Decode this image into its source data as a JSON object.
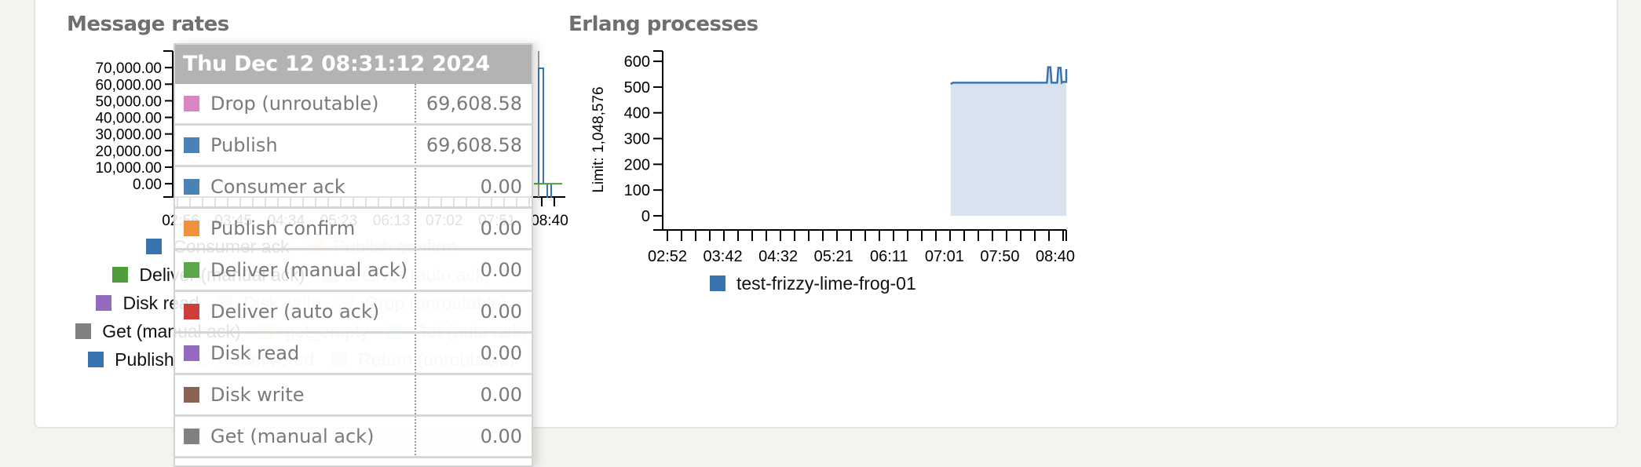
{
  "message_rates": {
    "title": "Message rates",
    "chart_data": {
      "type": "line",
      "title": "Message rates",
      "y_ticks": [
        "70,000.00",
        "60,000.00",
        "50,000.00",
        "40,000.00",
        "30,000.00",
        "20,000.00",
        "10,000.00",
        "0.00"
      ],
      "y_tick_values": [
        70000,
        60000,
        50000,
        40000,
        30000,
        20000,
        10000,
        0
      ],
      "ylim": [
        -8000,
        80000
      ],
      "x_ticks": [
        "02:56",
        "03:45",
        "04:34",
        "05:23",
        "06:13",
        "07:02",
        "07:51",
        "08:40"
      ],
      "series": [
        {
          "name": "Publish",
          "color": "#3a74b0",
          "note": "spike near 08:31",
          "peak": 69608.58
        },
        {
          "name": "Drop (unroutable)",
          "color": "#d785c3",
          "peak": 69608.58
        },
        {
          "name": "Deliver (manual ack)",
          "color": "#4f9d3a",
          "value": 0
        }
      ]
    },
    "legend_rows": [
      [
        {
          "label": "Consumer ack",
          "color": "#3a74b0"
        },
        {
          "label": "Publish confirm",
          "color": "#f0913f"
        }
      ],
      [
        {
          "label": "Deliver (manual ack)",
          "color": "#4f9d3a"
        },
        {
          "label": "Deliver (auto ack)",
          "color": "#cc3f3a"
        }
      ],
      [
        {
          "label": "Disk read",
          "color": "#936ac0"
        },
        {
          "label": "Disk write",
          "color": "#8c6255"
        },
        {
          "label": "Drop (unroutable)",
          "color": "#d785c3"
        }
      ],
      [
        {
          "label": "Get (manual ack)",
          "color": "#808080"
        },
        {
          "label": "get_empty",
          "color": "#bcbd22"
        },
        {
          "label": "Get (auto ack)",
          "color": "#17becf"
        }
      ],
      [
        {
          "label": "Publish",
          "color": "#3a74b0"
        },
        {
          "label": "Redelivered",
          "color": "#f0913f"
        },
        {
          "label": "Return (unroutable)",
          "color": "#4f9d3a"
        }
      ]
    ]
  },
  "tooltip": {
    "timestamp": "Thu Dec 12 08:31:12 2024",
    "rows": [
      {
        "label": "Drop (unroutable)",
        "value": "69,608.58",
        "color": "#d785c3"
      },
      {
        "label": "Publish",
        "value": "69,608.58",
        "color": "#4a82b8"
      },
      {
        "label": "Consumer ack",
        "value": "0.00",
        "color": "#4a82b8"
      },
      {
        "label": "Publish confirm",
        "value": "0.00",
        "color": "#f0913f"
      },
      {
        "label": "Deliver (manual ack)",
        "value": "0.00",
        "color": "#5aa64a"
      },
      {
        "label": "Deliver (auto ack)",
        "value": "0.00",
        "color": "#cc3f3a"
      },
      {
        "label": "Disk read",
        "value": "0.00",
        "color": "#936ac0"
      },
      {
        "label": "Disk write",
        "value": "0.00",
        "color": "#8c6255"
      },
      {
        "label": "Get (manual ack)",
        "value": "0.00",
        "color": "#808080"
      }
    ]
  },
  "erlang_processes": {
    "title": "Erlang processes",
    "chart_data": {
      "type": "area",
      "title": "Erlang processes",
      "ylabel": "Limit: 1,048,576",
      "y_ticks": [
        "600",
        "500",
        "400",
        "300",
        "200",
        "100",
        "0"
      ],
      "y_tick_values": [
        600,
        500,
        400,
        300,
        200,
        100,
        0
      ],
      "ylim": [
        -55,
        640
      ],
      "x_ticks": [
        "02:52",
        "03:42",
        "04:32",
        "05:21",
        "06:11",
        "07:01",
        "07:50",
        "08:40"
      ],
      "x_range_minutes": [
        170,
        522
      ],
      "series": [
        {
          "name": "test-frizzy-lime-frog-01",
          "color": "#3a74b0",
          "points": [
            [
              420,
              512
            ],
            [
              422,
              517
            ],
            [
              505,
              517
            ],
            [
              506,
              577
            ],
            [
              508,
              577
            ],
            [
              509,
              517
            ],
            [
              514,
              517
            ],
            [
              515,
              575
            ],
            [
              517,
              575
            ],
            [
              518,
              517
            ],
            [
              519,
              520
            ],
            [
              522,
              520
            ],
            [
              522,
              570
            ]
          ]
        }
      ],
      "legend": [
        "test-frizzy-lime-frog-01"
      ]
    }
  }
}
